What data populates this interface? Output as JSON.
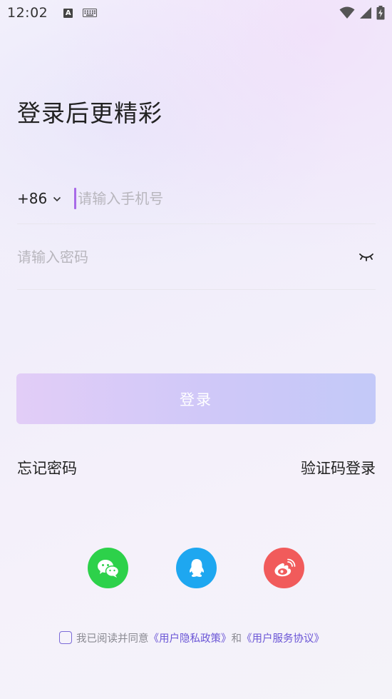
{
  "status_bar": {
    "time": "12:02",
    "keyboard_icon": "keyboard-icon",
    "a_label": "A"
  },
  "login": {
    "title": "登录后更精彩",
    "country_code": "+86",
    "phone_placeholder": "请输入手机号",
    "password_placeholder": "请输入密码",
    "login_button": "登录",
    "forgot_password": "忘记密码",
    "sms_login": "验证码登录"
  },
  "social": {
    "wechat": "wechat-icon",
    "qq": "qq-icon",
    "weibo": "weibo-icon"
  },
  "agreement": {
    "prefix": "我已阅读并同意",
    "privacy": "《用户隐私政策》",
    "and": "和",
    "service": "《用户服务协议》"
  },
  "colors": {
    "wechat": "#2dd14a",
    "qq": "#1ea7f0",
    "weibo": "#f15b5b",
    "accent": "#6a55d6",
    "caret": "#a86be8"
  }
}
